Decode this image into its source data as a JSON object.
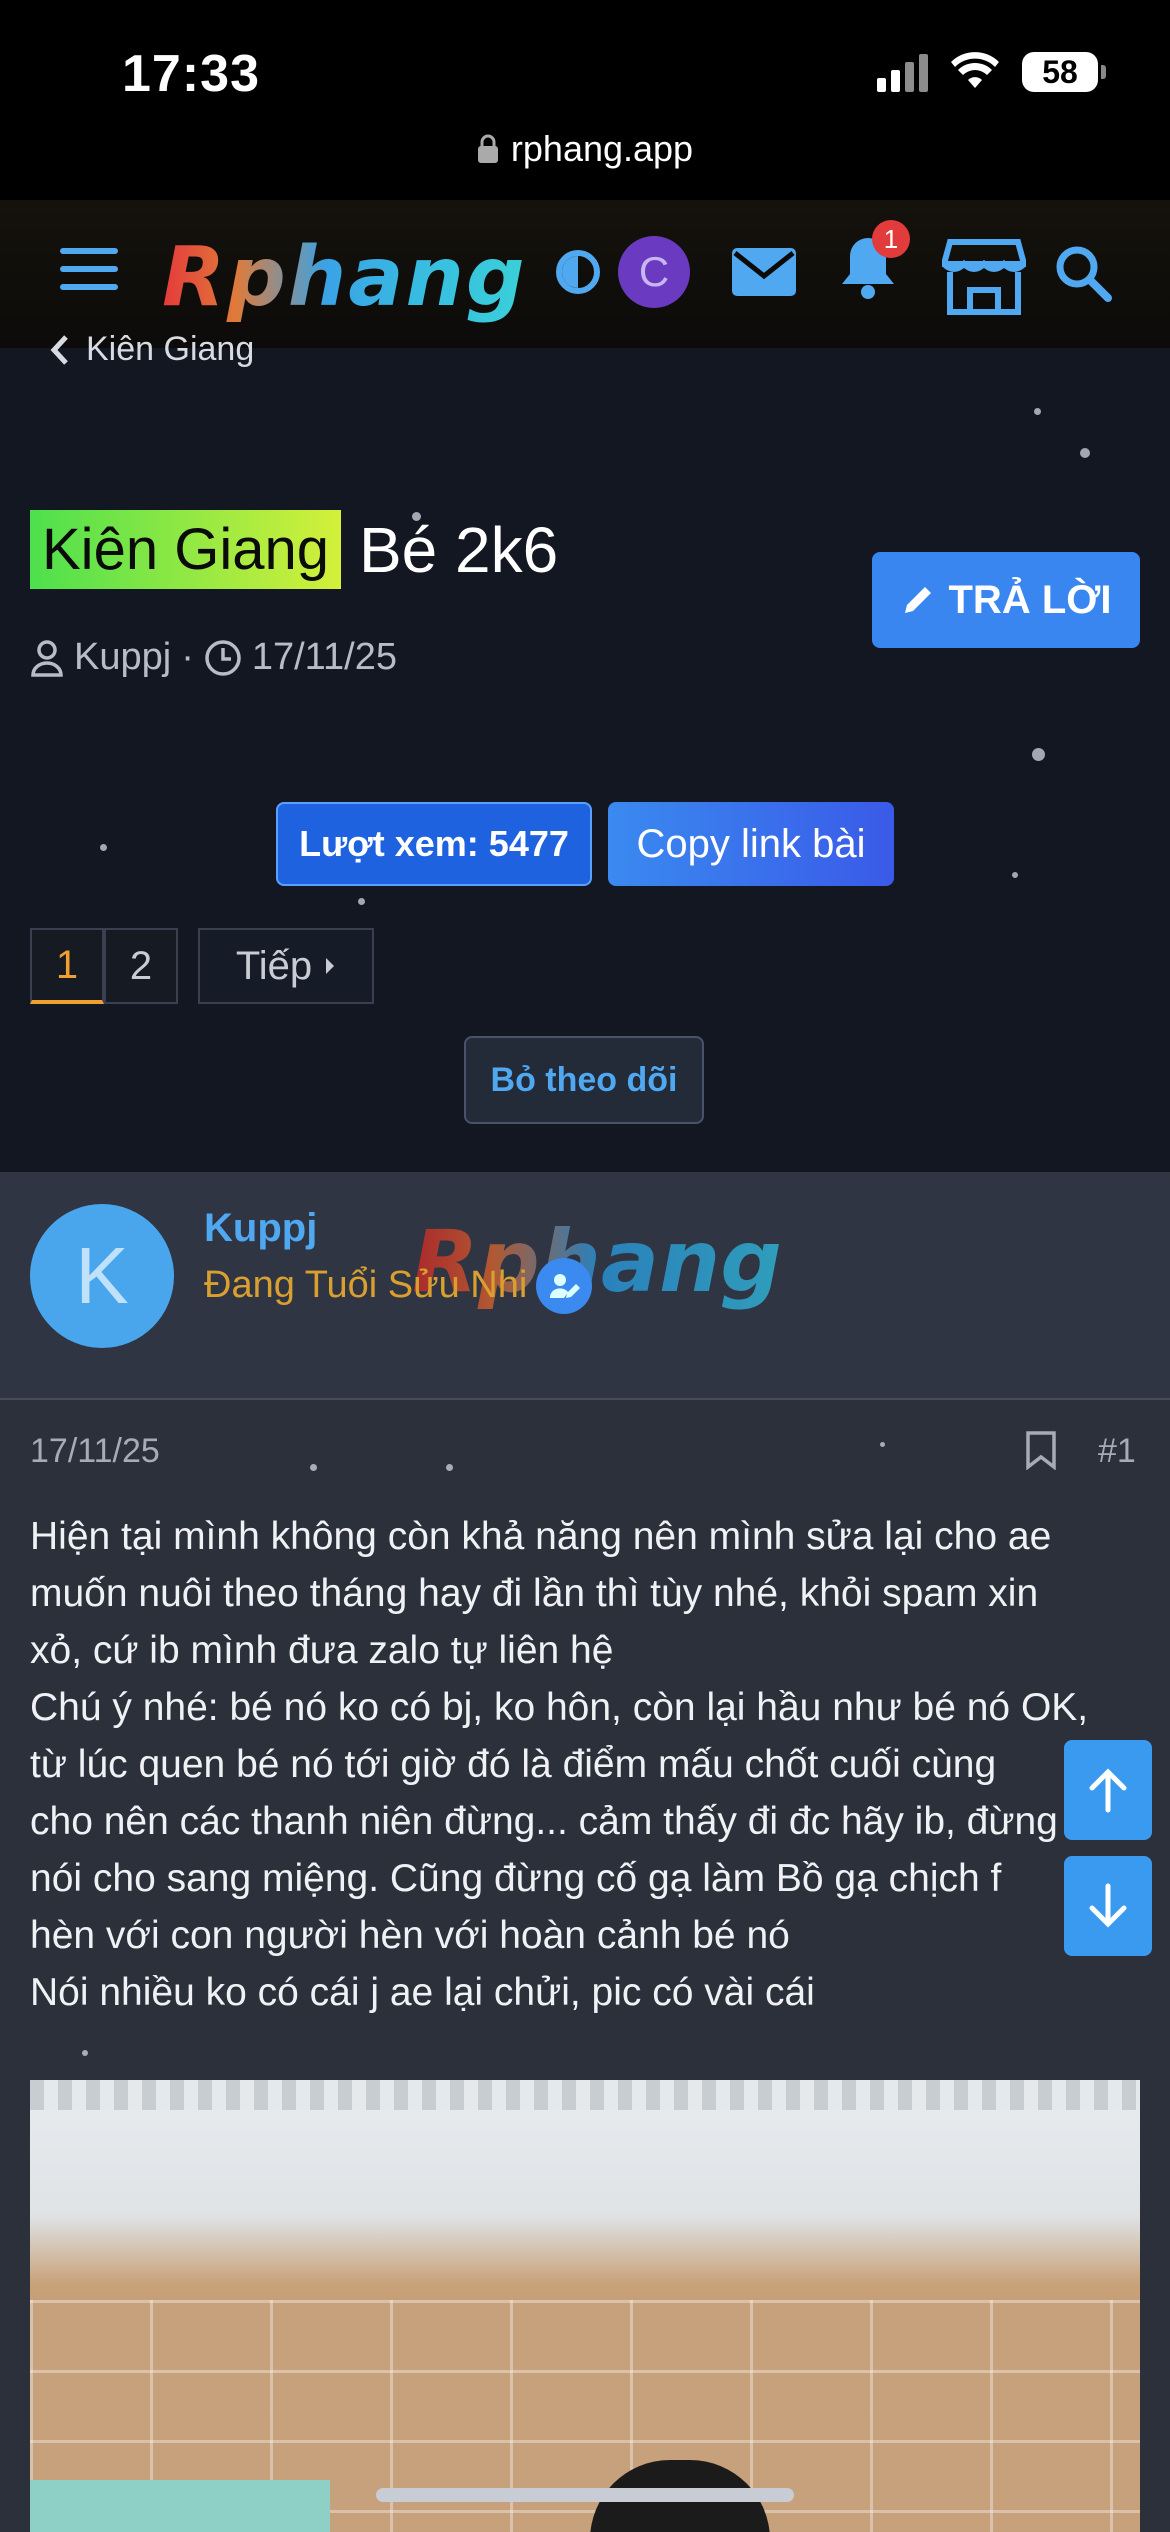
{
  "status_bar": {
    "time": "17:33",
    "battery": "58"
  },
  "browser": {
    "url": "rphang.app"
  },
  "header": {
    "logo": "Rphang",
    "avatar_letter": "C",
    "notification_count": "1",
    "accent_color": "#4fa8f0"
  },
  "breadcrumb": {
    "label": "Kiên Giang"
  },
  "thread": {
    "prefix": "Kiên Giang",
    "title": "Bé 2k6",
    "author": "Kuppj",
    "date": "17/11/25",
    "reply_label": "TRẢ LỜI",
    "views_label": "Lượt xem: 5477",
    "copy_link_label": "Copy link bài",
    "unfollow_label": "Bỏ theo dõi"
  },
  "pagination": {
    "pages": [
      "1",
      "2"
    ],
    "current": "1",
    "next_label": "Tiếp"
  },
  "post": {
    "avatar_letter": "K",
    "username": "Kuppj",
    "rank": "Đang Tuổi Sửu Nhi",
    "watermark": "Rphang",
    "date": "17/11/25",
    "number": "#1",
    "lines": [
      "Hiện tại mình không còn khả năng nên mình sửa lại cho ae",
      "muốn nuôi theo tháng hay đi lần thì tùy nhé, khỏi spam xin",
      "xỏ, cứ ib mình đưa zalo tự liên hệ",
      "Chú ý nhé: bé nó ko có bj, ko hôn, còn lại hầu như bé nó OK,",
      "từ lúc quen bé nó tới giờ đó là điểm mấu chốt cuối cùng",
      "cho nên các thanh niên đừng... cảm thấy đi đc hãy ib, đừng",
      "nói cho sang miệng. Cũng đừng cố gạ làm Bồ gạ chịch f",
      "hèn với con người hèn với hoàn cảnh bé nó",
      "Nói nhiều ko có cái j ae lại chửi, pic có vài cái"
    ]
  }
}
